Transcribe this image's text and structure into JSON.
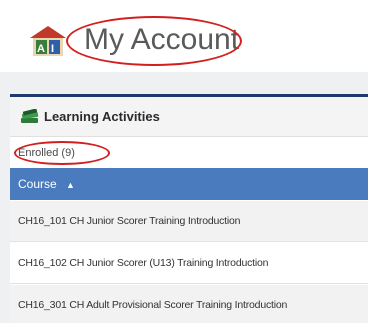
{
  "header": {
    "title": "My Account",
    "logo_icon": "account-logo-icon"
  },
  "panel": {
    "title": "Learning Activities",
    "icon": "books-icon"
  },
  "enrolled": {
    "label": "Enrolled (9)"
  },
  "table": {
    "column_header": "Course",
    "sort_indicator": "▲",
    "rows": [
      {
        "course": "CH16_101 CH Junior Scorer Training Introduction"
      },
      {
        "course": "CH16_102 CH Junior Scorer (U13) Training Introduction"
      },
      {
        "course": "CH16_301 CH Adult Provisional Scorer Training Introduction"
      }
    ]
  },
  "colors": {
    "accent_blue": "#4a7bbf",
    "panel_border": "#1d3c6e",
    "annotation_red": "#d21f1f"
  }
}
